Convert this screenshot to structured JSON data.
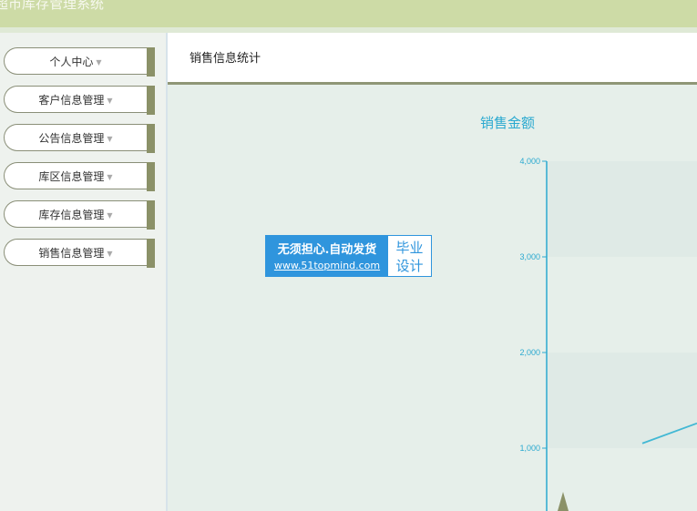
{
  "app": {
    "title": "超市库存管理系统"
  },
  "sidebar": {
    "items": [
      {
        "label": "个人中心"
      },
      {
        "label": "客户信息管理"
      },
      {
        "label": "公告信息管理"
      },
      {
        "label": "库区信息管理"
      },
      {
        "label": "库存信息管理"
      },
      {
        "label": "销售信息管理"
      }
    ],
    "caret_glyph": "▼"
  },
  "main": {
    "tab_title": "销售信息统计"
  },
  "watermark": {
    "line1": "无须担心.自动发货",
    "line2": "www.51topmind.com",
    "right_top": "毕业",
    "right_bottom": "设计"
  },
  "chart_data": {
    "type": "line",
    "title": "销售金额",
    "ylim": [
      0,
      4000
    ],
    "y_ticks": [
      "1,000",
      "2,000",
      "3,000",
      "4,000"
    ],
    "y_tick_values": [
      1000,
      2000,
      3000,
      4000
    ],
    "visible_line_points": [
      [
        1,
        1050
      ],
      [
        2,
        1260
      ]
    ],
    "colors": {
      "axis": "#2aa9d0",
      "line": "#42b8d4",
      "band": "#dfeae6",
      "area": "#8b9168"
    }
  }
}
